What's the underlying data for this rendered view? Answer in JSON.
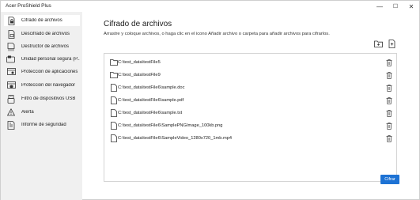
{
  "window": {
    "title": "Acer ProShield Plus",
    "minimize": "—",
    "maximize": "☐",
    "close": "✕"
  },
  "sidebar": {
    "items": [
      {
        "label": "Cifrado de archivos",
        "icon": "file-lock-icon",
        "active": true
      },
      {
        "label": "Descifrado de archivos",
        "icon": "file-unlock-icon"
      },
      {
        "label": "Destructor de archivos",
        "icon": "file-shred-icon"
      },
      {
        "label": "Unidad personal segura (P...",
        "icon": "drive-icon"
      },
      {
        "label": "Protección de aplicaciones",
        "icon": "app-shield-icon"
      },
      {
        "label": "Protección del navegador",
        "icon": "browser-icon"
      },
      {
        "label": "Filtro de dispositivos USB",
        "icon": "usb-icon"
      },
      {
        "label": "Alerta",
        "icon": "alert-icon"
      },
      {
        "label": "Informe de seguridad",
        "icon": "report-icon"
      }
    ]
  },
  "main": {
    "title": "Cifrado de archivos",
    "subtitle": "Arrastre y coloque archivos, o haga clic en el icono Añadir archivo o carpeta para añadir archivos para cifrarlos.",
    "tools": {
      "add_folder_icon": "add-folder-icon",
      "add_file_icon": "add-file-icon"
    },
    "files": [
      {
        "path": "C:\\test_data\\testFile5",
        "type": "folder"
      },
      {
        "path": "C:\\test_data\\testFile9",
        "type": "folder"
      },
      {
        "path": "C:\\test_data\\testFile6\\sample.doc",
        "type": "file"
      },
      {
        "path": "C:\\test_data\\testFile6\\sample.pdf",
        "type": "file"
      },
      {
        "path": "C:\\test_data\\testFile6\\sample.txt",
        "type": "file"
      },
      {
        "path": "C:\\test_data\\testFile6\\SamplePNGImage_100kb.png",
        "type": "file"
      },
      {
        "path": "C:\\test_data\\testFile6\\SampleVideo_1280x720_1mb.mp4",
        "type": "file"
      }
    ],
    "encrypt_button": "Cifrar"
  },
  "colors": {
    "accent": "#1d72d4",
    "sidebar_bg": "#f0f0f0",
    "border": "#d4d4d4"
  }
}
